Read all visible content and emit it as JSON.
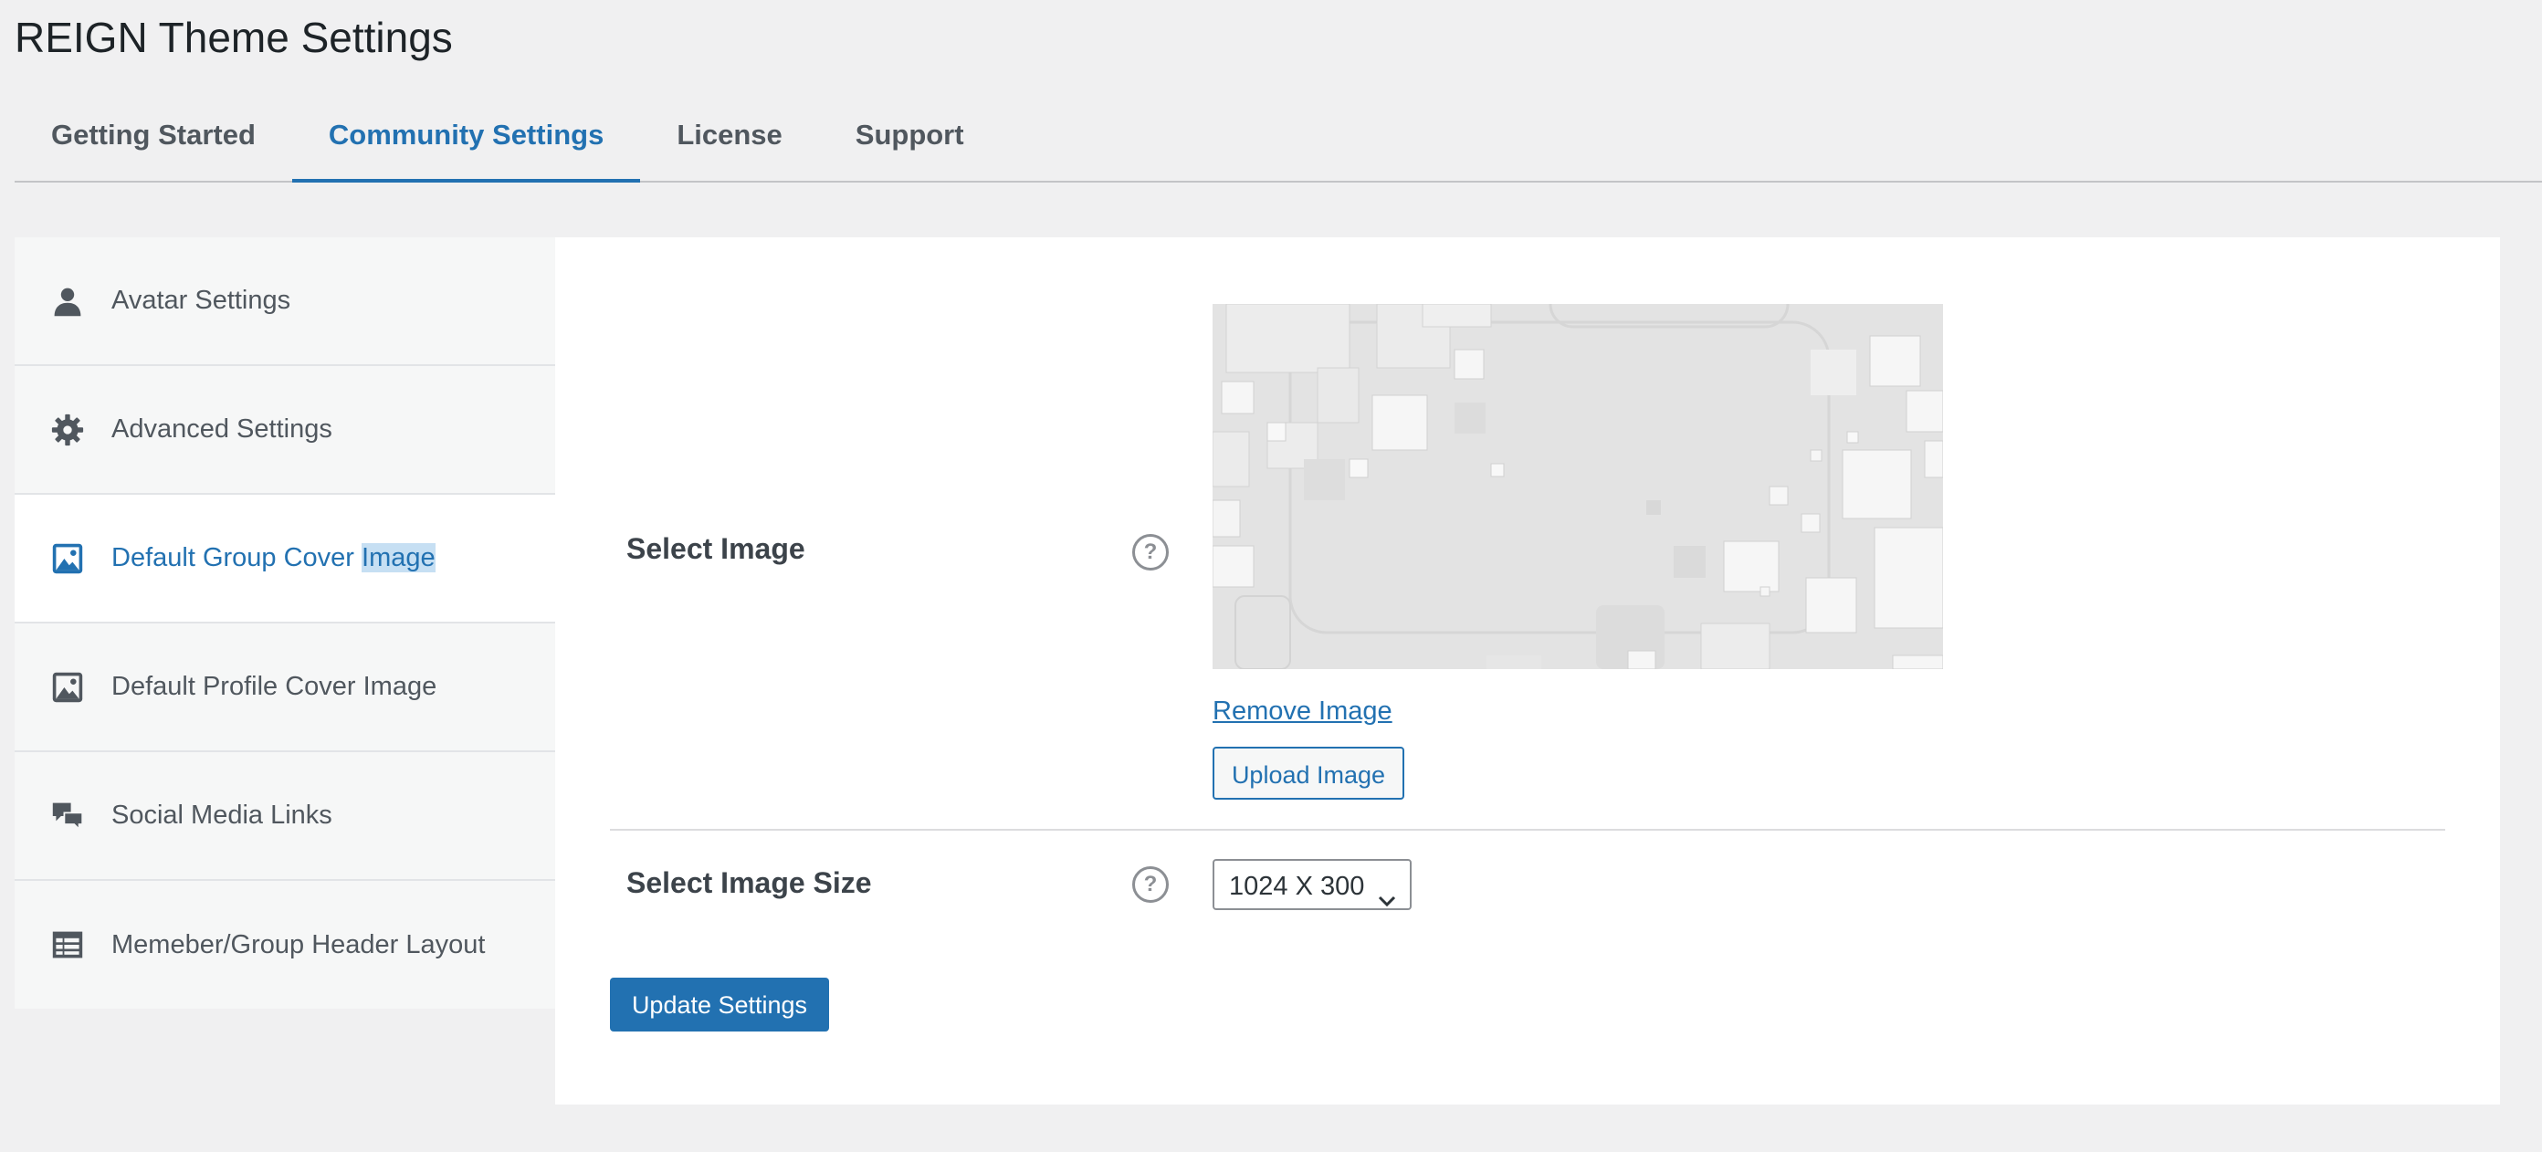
{
  "page": {
    "title": "REIGN Theme Settings"
  },
  "tabs": [
    {
      "label": "Getting Started",
      "active": false
    },
    {
      "label": "Community Settings",
      "active": true
    },
    {
      "label": "License",
      "active": false
    },
    {
      "label": "Support",
      "active": false
    }
  ],
  "sidebar": {
    "items": [
      {
        "label": "Avatar Settings",
        "icon": "user-icon"
      },
      {
        "label": "Advanced Settings",
        "icon": "gear-icon"
      },
      {
        "label_prefix": "Default Group Cover ",
        "label_selected": "Image",
        "icon": "image-icon",
        "active": true
      },
      {
        "label": "Default Profile Cover Image",
        "icon": "image-icon"
      },
      {
        "label": "Social Media Links",
        "icon": "chat-bubbles-icon"
      },
      {
        "label": "Memeber/Group Header Layout",
        "icon": "layout-icon"
      }
    ]
  },
  "form": {
    "select_image_label": "Select Image",
    "remove_image_label": "Remove Image",
    "upload_image_label": "Upload Image",
    "select_image_size_label": "Select Image Size",
    "image_size_value": "1024 X 300",
    "help_glyph": "?",
    "update_button_label": "Update Settings"
  },
  "colors": {
    "accent": "#2271b1",
    "page_bg": "#f0f0f1",
    "sidebar_bg": "#f6f7f7",
    "text_selection": "#c6dff3"
  }
}
